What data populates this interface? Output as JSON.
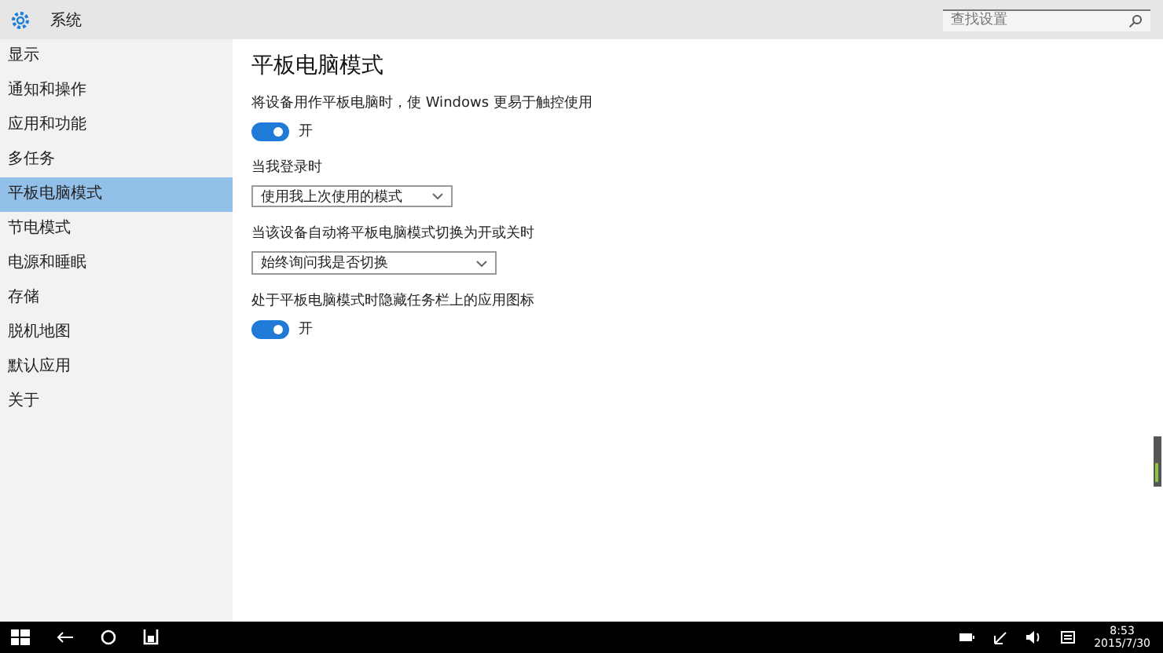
{
  "window": {
    "title": "系统"
  },
  "search": {
    "placeholder": "查找设置"
  },
  "sidebar": {
    "items": [
      {
        "label": "显示",
        "selected": false
      },
      {
        "label": "通知和操作",
        "selected": false
      },
      {
        "label": "应用和功能",
        "selected": false
      },
      {
        "label": "多任务",
        "selected": false
      },
      {
        "label": "平板电脑模式",
        "selected": true
      },
      {
        "label": "节电模式",
        "selected": false
      },
      {
        "label": "电源和睡眠",
        "selected": false
      },
      {
        "label": "存储",
        "selected": false
      },
      {
        "label": "脱机地图",
        "selected": false
      },
      {
        "label": "默认应用",
        "selected": false
      },
      {
        "label": "关于",
        "selected": false
      }
    ]
  },
  "page": {
    "title": "平板电脑模式",
    "settings": [
      {
        "kind": "toggle",
        "label": "将设备用作平板电脑时，使 Windows 更易于触控使用",
        "on": true,
        "state_text": "开"
      },
      {
        "kind": "dropdown",
        "label": "当我登录时",
        "value": "使用我上次使用的模式"
      },
      {
        "kind": "dropdown",
        "label": "当该设备自动将平板电脑模式切换为开或关时",
        "value": "始终询问我是否切换"
      },
      {
        "kind": "toggle",
        "label": "处于平板电脑模式时隐藏任务栏上的应用图标",
        "on": true,
        "state_text": "开"
      }
    ]
  },
  "taskbar": {
    "time": "8:53",
    "date": "2015/7/30"
  }
}
